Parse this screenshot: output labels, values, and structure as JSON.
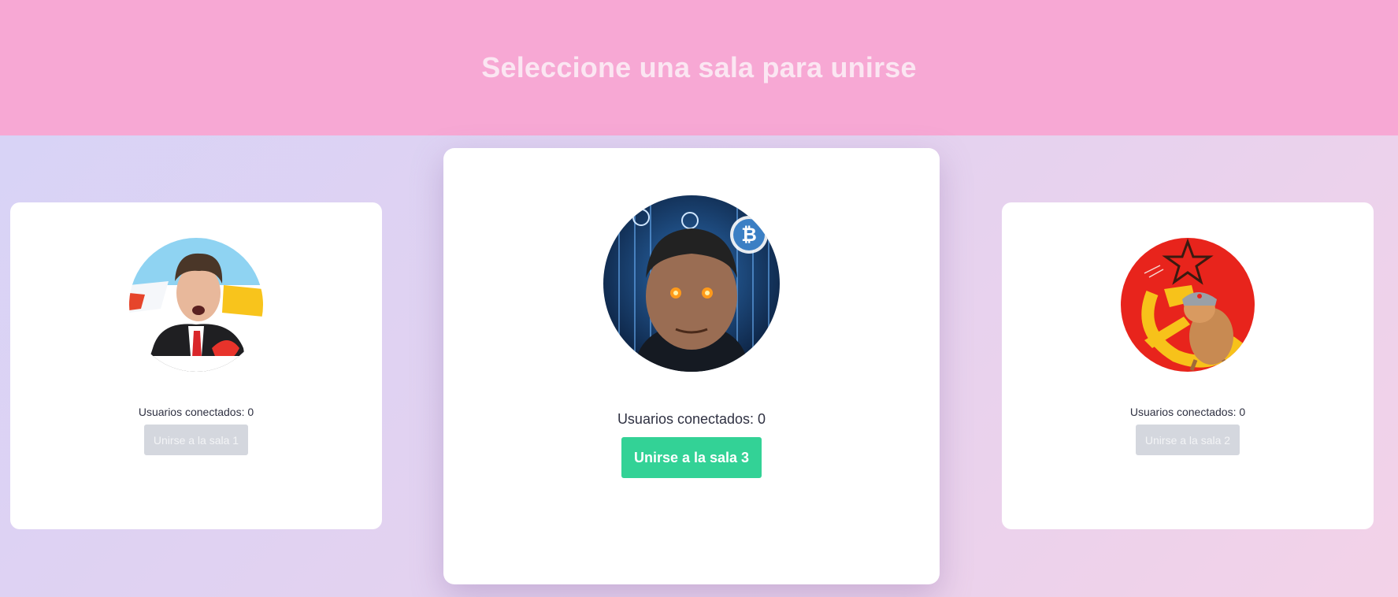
{
  "header": {
    "title": "Seleccione una sala para unirse"
  },
  "rooms": [
    {
      "users_label": "Usuarios conectados: 0",
      "button_label": "Unirse a la sala 1",
      "button_enabled": false
    },
    {
      "users_label": "Usuarios conectados: 0",
      "button_label": "Unirse a la sala 3",
      "button_enabled": true
    },
    {
      "users_label": "Usuarios conectados: 0",
      "button_label": "Unirse a la sala 2",
      "button_enabled": false
    }
  ],
  "colors": {
    "header_bg": "#f7a8d4",
    "header_text": "#fbe6f2",
    "active_button": "#33d296",
    "disabled_button": "#d4d7de"
  }
}
